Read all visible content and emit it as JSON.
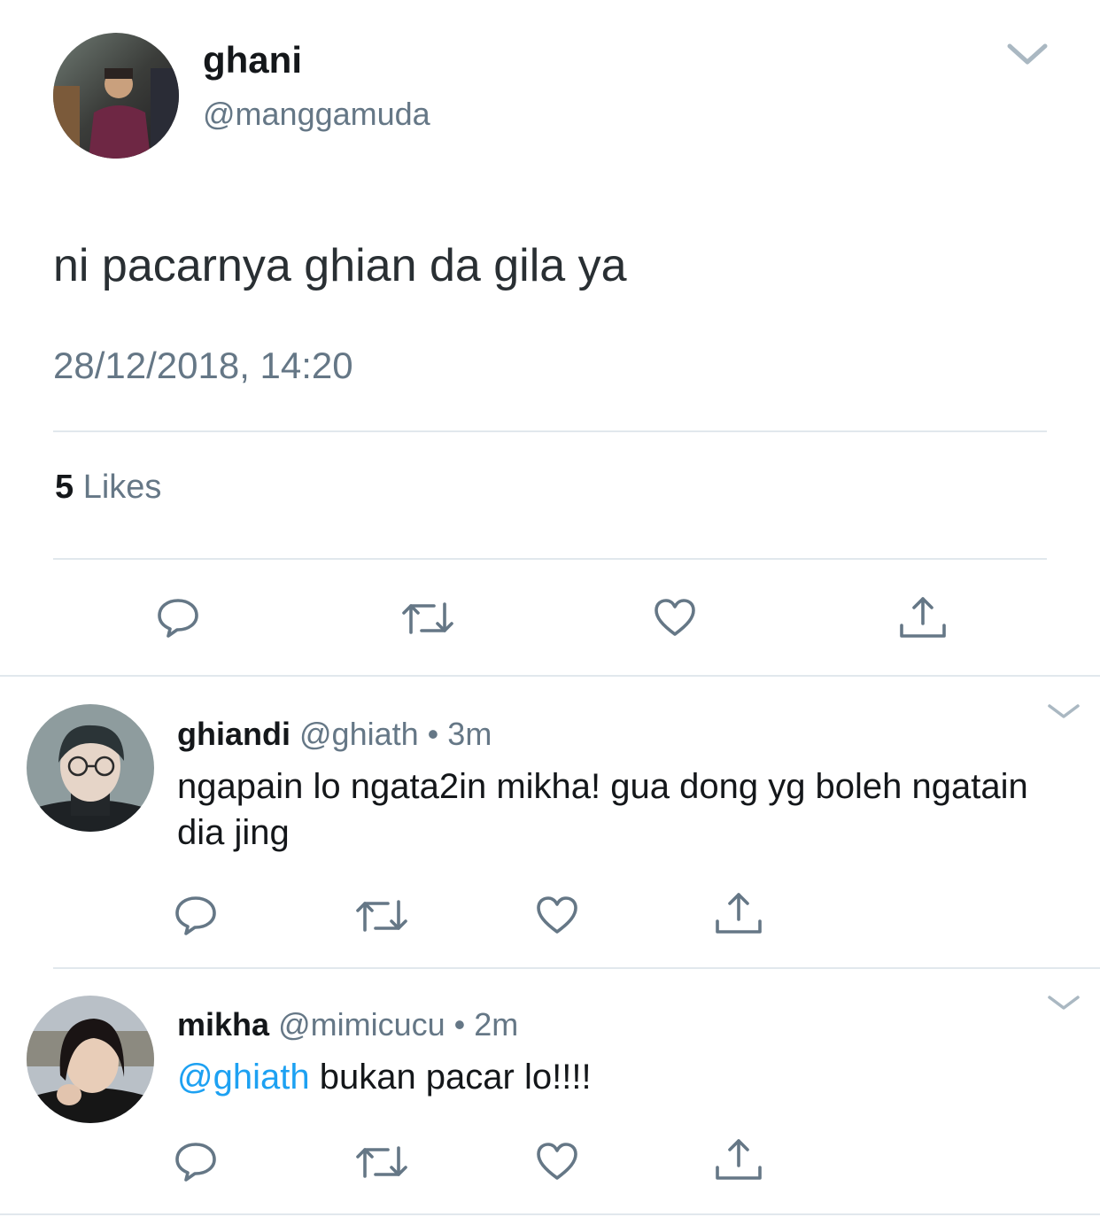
{
  "tweet": {
    "author_name": "ghani",
    "author_handle": "@manggamuda",
    "text": "ni pacarnya ghian da gila ya",
    "timestamp": "28/12/2018, 14:20",
    "likes_count": "5",
    "likes_label": "Likes",
    "icons": [
      "reply-icon",
      "retweet-icon",
      "like-icon",
      "share-icon",
      "chevron-down-icon"
    ]
  },
  "replies": [
    {
      "name": "ghiandi",
      "handle": "@ghiath",
      "dot": "•",
      "time": "3m",
      "text": "ngapain lo ngata2in mikha! gua dong yg boleh ngatain dia jing"
    },
    {
      "name": "mikha",
      "handle": "@mimicucu",
      "dot": "•",
      "time": "2m",
      "mention": "@ghiath",
      "text": " bukan pacar lo!!!!"
    }
  ],
  "colors": {
    "text": "#14171a",
    "secondary": "#657786",
    "icon": "#657786",
    "link": "#1da1f2",
    "divider": "#e1e8ed"
  }
}
